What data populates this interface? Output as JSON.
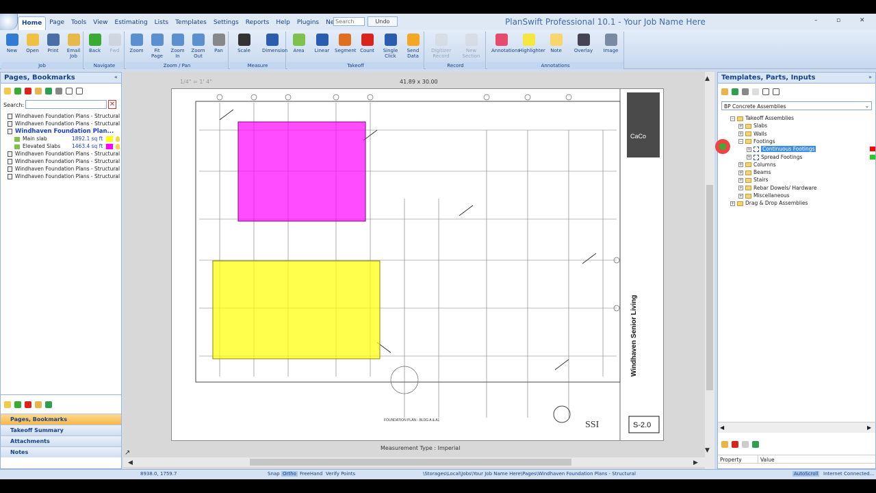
{
  "app": {
    "title": "PlanSwift Professional 10.1 - Your Job Name Here",
    "search_placeholder": "Search",
    "undo_label": "Undo",
    "window_controls": [
      "–",
      "▫",
      "✕"
    ]
  },
  "menu_tabs": [
    "Home",
    "Page",
    "Tools",
    "View",
    "Estimating",
    "Lists",
    "Templates",
    "Settings",
    "Reports",
    "Help",
    "Plugins",
    "Need Work?"
  ],
  "ribbon": {
    "groups": [
      {
        "label": "Job",
        "buttons": [
          "New",
          "Open",
          "Print",
          "Email\nJob"
        ]
      },
      {
        "label": "Navigate",
        "buttons": [
          "Back",
          "Fwd"
        ]
      },
      {
        "label": "Zoom / Pan",
        "buttons": [
          "Zoom",
          "Fit\nPage",
          "Zoom\nIn",
          "Zoom\nOut",
          "Pan"
        ]
      },
      {
        "label": "Measure",
        "buttons": [
          "Scale",
          "Dimension"
        ]
      },
      {
        "label": "Takeoff",
        "buttons": [
          "Area",
          "Linear",
          "Segment",
          "Count",
          "Single\nClick",
          "Send\nData"
        ]
      },
      {
        "label": "Record",
        "buttons": [
          "Digitizer\nRecord",
          "New\nSection"
        ]
      },
      {
        "label": "Annotations",
        "buttons": [
          "Annotations",
          "Highlighter",
          "Note",
          "Overlay",
          "Image"
        ]
      }
    ]
  },
  "left_panel": {
    "title": "Pages, Bookmarks",
    "search_label": "Search:",
    "pages": [
      "Windhaven Foundation Plans - Structural",
      "Windhaven Foundation Plans - Structural",
      "Windhaven Foundation Plan...",
      "Windhaven Foundation Plans - Structural",
      "Windhaven Foundation Plans - Structural",
      "Windhaven Foundation Plans - Structural",
      "Windhaven Foundation Plans - Structural"
    ],
    "takeoffs": [
      {
        "name": "Main slab",
        "value": "1892.1 sq ft",
        "color": "#ffff00"
      },
      {
        "name": "Elevated Slabs",
        "value": "1463.4 sq ft",
        "color": "#ff00ff"
      }
    ],
    "nav": [
      "Pages, Bookmarks",
      "Takeoff Summary",
      "Attachments",
      "Notes"
    ]
  },
  "canvas": {
    "scale_label": "1/4\" = 1' 4\"",
    "dimensions": "41.89 x 30.00",
    "measurement_type": "Measurement Type : Imperial",
    "sheet_title": "Windhaven Senior Living",
    "sheet_number": "S-2.0",
    "plan_caption": "FOUNDATION PLAN - BLDG A & A1",
    "logo_text": "CaCo",
    "firm_text": "SSI",
    "areas": [
      {
        "name": "Elevated Slabs",
        "color": "#ff00ff"
      },
      {
        "name": "Main slab",
        "color": "#ffff00"
      }
    ]
  },
  "right_panel": {
    "title": "Templates, Parts, Inputs",
    "dropdown": "BP Concrete Assemblies",
    "tree": [
      {
        "label": "Takeoff Assemblies",
        "indent": 0,
        "type": "folder"
      },
      {
        "label": "Slabs",
        "indent": 1,
        "type": "folder"
      },
      {
        "label": "Walls",
        "indent": 1,
        "type": "folder"
      },
      {
        "label": "Footings",
        "indent": 1,
        "type": "folder"
      },
      {
        "label": "Continuous Footings",
        "indent": 2,
        "type": "item",
        "selected": true,
        "color": "#ff0000"
      },
      {
        "label": "Spread Footings",
        "indent": 2,
        "type": "item",
        "color": "#22cc22"
      },
      {
        "label": "Columns",
        "indent": 1,
        "type": "folder"
      },
      {
        "label": "Beams",
        "indent": 1,
        "type": "folder"
      },
      {
        "label": "Stairs",
        "indent": 1,
        "type": "folder"
      },
      {
        "label": "Rebar Dowels/ Hardware",
        "indent": 1,
        "type": "folder"
      },
      {
        "label": "Miscellaneous",
        "indent": 1,
        "type": "folder"
      },
      {
        "label": "Drag & Drop Assemblies",
        "indent": 0,
        "type": "folder"
      }
    ],
    "property_header": "Property",
    "value_header": "Value"
  },
  "status": {
    "coords": "8938.0, 1759.7",
    "snap": "Snap",
    "ortho": "Ortho",
    "freehand": "FreeHand",
    "verify": "Verify Points",
    "path": "\\Storages\\Local\\Jobs\\Your Job Name Here\\Pages\\Windhaven Foundation Plans - Structural",
    "autoscroll": "AutoScroll",
    "internet": "Internet Connected..."
  }
}
